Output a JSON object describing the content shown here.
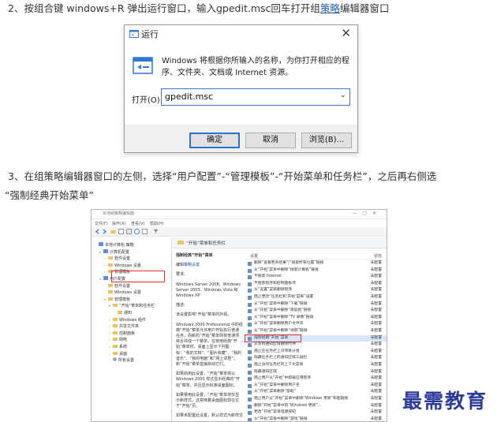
{
  "step2": {
    "prefix": "2、按组合键 windows+R 弹出运行窗口，输入gpedit.msc回车打开组",
    "link": "策略",
    "suffix": "编辑器窗口"
  },
  "run_dialog": {
    "title": "运行",
    "close": "✕",
    "description": "Windows 将根据你所输入的名称，为你打开相应的程序、文件夹、文档或 Internet 资源。",
    "open_label": "打开(O):",
    "input_value": "gpedit.msc",
    "ok": "确定",
    "cancel": "取消",
    "browse": "浏览(B)..."
  },
  "step3": {
    "line1": "3、在组策略编辑器窗口的左侧，选择“用户配置”-“管理模板”-“开始菜单和任务栏”，之后再右侧选",
    "line2": "“强制经典开始菜单”"
  },
  "gp_window": {
    "title": "本地组策略编辑器",
    "menu": [
      "文件(F)",
      "操作(A)",
      "查看(V)",
      "帮助(H)"
    ],
    "tree": [
      {
        "label": "本地计算机 策略",
        "indent": 0,
        "icon": "comp"
      },
      {
        "label": "计算机配置",
        "indent": 1,
        "icon": "comp"
      },
      {
        "label": "软件设置",
        "indent": 2,
        "icon": "fold"
      },
      {
        "label": "Windows 设置",
        "indent": 2,
        "icon": "fold"
      },
      {
        "label": "管理模板",
        "indent": 2,
        "icon": "fold"
      },
      {
        "label": "用户配置",
        "indent": 1,
        "icon": "comp"
      },
      {
        "label": "软件设置",
        "indent": 2,
        "icon": "fold"
      },
      {
        "label": "Windows 设置",
        "indent": 2,
        "icon": "fold"
      },
      {
        "label": "管理模板",
        "indent": 2,
        "icon": "fold"
      },
      {
        "label": "“开始”菜单和任务栏",
        "indent": 3,
        "icon": "fold"
      },
      {
        "label": "通知",
        "indent": 4,
        "icon": "fold"
      },
      {
        "label": "Windows 组件",
        "indent": 3,
        "icon": "fold"
      },
      {
        "label": "共享文件夹",
        "indent": 3,
        "icon": "fold"
      },
      {
        "label": "控制面板",
        "indent": 3,
        "icon": "fold"
      },
      {
        "label": "网络",
        "indent": 3,
        "icon": "fold"
      },
      {
        "label": "系统",
        "indent": 3,
        "icon": "fold"
      },
      {
        "label": "桌面",
        "indent": 3,
        "icon": "fold"
      },
      {
        "label": "所有设置",
        "indent": 3,
        "icon": "gear"
      }
    ],
    "header": "“开始”菜单和任务栏",
    "desc": {
      "title": "强制经典“开始”菜单",
      "edit_prefix": "编辑",
      "edit_link": "策略设置",
      "req_label": "要求:",
      "req_text": "Windows Server 2008、Windows Server 2003、Windows Vista 和 Windows XP",
      "desc_label": "描述:",
      "desc_text": "该设置影响“开始”菜单的外观。",
      "p1": "Windows 2000 Professional 中的经典“开始”菜单允许用户开始执行普通任务，而新的“开始”菜单则将普通项目合并成一个菜单。在使用经典“开始”菜单时，桌面上显示下列图标：“我的文档”、“图片收藏”、“我的音乐”、“我的电脑”和“网上邻居”。新“开始”菜单直接启动它们。",
      "p2": "如果启用此设置，“开始”菜单将以 Windows 2000 样式显示经典的“开始”菜单，并且显示标准桌面图标。",
      "p3": "如果禁用此设置，“开始”菜单将仅显示新样式，这意味着桌面图标现在位于“开始”页。",
      "p4": "如果未配置此设置，默认样式为新样式"
    },
    "list_header": {
      "setting": "设置",
      "state": "状态"
    },
    "rows": [
      {
        "name": "删除“查看更多结果”/“搜索所有位置”链接",
        "state": "未配置"
      },
      {
        "name": "从“开始”菜单中删除“搜索计算机”链接",
        "state": "未配置"
      },
      {
        "name": "不搜索 Internet",
        "state": "未配置"
      },
      {
        "name": "不搜索程序和控制面板项",
        "state": "未配置"
      },
      {
        "name": "从“设置”菜单删除程序",
        "state": "未配置"
      },
      {
        "name": "阻止更改“任务栏和‘开始’菜单”设置",
        "state": "未配置"
      },
      {
        "name": "从“开始”菜单中删除“下载”链接",
        "state": "未配置"
      },
      {
        "name": "从“开始”菜单中删除“家庭组”链接",
        "state": "未配置"
      },
      {
        "name": "从“开始”菜单中删除“TV 录像”链接",
        "state": "未配置"
      },
      {
        "name": "从“开始”菜单删除用户文件夹",
        "state": "未配置"
      },
      {
        "name": "从“开始”菜单中删除“视频”链接",
        "state": "未配置"
      },
      {
        "name": "强制经典“开始”菜单",
        "state": "未配置"
      },
      {
        "name": "从系统通知区域删除时钟",
        "state": "未配置"
      },
      {
        "name": "阻止在任务栏上对项目分组",
        "state": "未配置"
      },
      {
        "name": "隐藏任务栏上的通知区域工具栏",
        "state": "未配置"
      },
      {
        "name": "阻止访问任务栏的上下文菜单",
        "state": "未配置"
      },
      {
        "name": "隐藏通知区域",
        "state": "未配置"
      },
      {
        "name": "阻止用户从“开始”中卸载应用程序",
        "state": "未配置"
      },
      {
        "name": "从“开始”菜单中删除用户名",
        "state": "未配置"
      },
      {
        "name": "从“开始”菜单删除“帮助”",
        "state": "未配置"
      },
      {
        "name": "阻止用户从“开始”菜单中删除“Windows 更新”和超链接",
        "state": "未配置"
      },
      {
        "name": "删除“开始”菜单中的“Windows 更新”...",
        "state": "未配置"
      },
      {
        "name": "更改“开始”菜单电源按钮",
        "state": "未配置"
      },
      {
        "name": "从“开始”菜单中删除“游戏”链接",
        "state": "未配置"
      }
    ]
  },
  "watermark": "最需教育",
  "colors": {
    "link": "#1a5fb4",
    "highlight": "#e0302a",
    "watermark": "#2c3c9a"
  }
}
